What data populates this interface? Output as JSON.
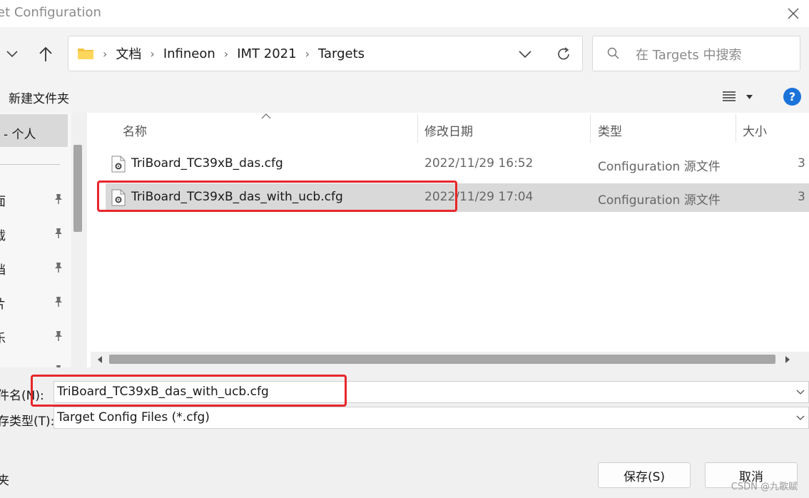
{
  "window": {
    "title": "et Configuration"
  },
  "nav": {
    "breadcrumbs": [
      "文档",
      "Infineon",
      "IMT 2021",
      "Targets"
    ],
    "search_placeholder": "在 Targets 中搜索"
  },
  "toolbar": {
    "new_folder": "新建文件夹"
  },
  "sidebar": {
    "selected": "- 个人",
    "items": [
      "面",
      "载",
      "档",
      "片",
      "乐",
      ""
    ]
  },
  "columns": {
    "name": "名称",
    "modified": "修改日期",
    "type": "类型",
    "size": "大小"
  },
  "files": [
    {
      "name": "TriBoard_TC39xB_das.cfg",
      "modified": "2022/11/29 16:52",
      "type": "Configuration 源文件",
      "size": "3",
      "selected": false
    },
    {
      "name": "TriBoard_TC39xB_das_with_ucb.cfg",
      "modified": "2022/11/29 17:04",
      "type": "Configuration 源文件",
      "size": "3",
      "selected": true
    }
  ],
  "form": {
    "filename_label": "件名(N):",
    "filename_value": "TriBoard_TC39xB_das_with_ucb.cfg",
    "filetype_label": "存类型(T):",
    "filetype_value": "Target Config Files (*.cfg)",
    "folder_label": "夹"
  },
  "buttons": {
    "save": "保存(S)",
    "cancel": "取消"
  },
  "watermark": "CSDN @九歌赋",
  "colors": {
    "highlight": "#e8262b",
    "selected_row": "#d9d9d9",
    "help_blue": "#1a73d9"
  }
}
